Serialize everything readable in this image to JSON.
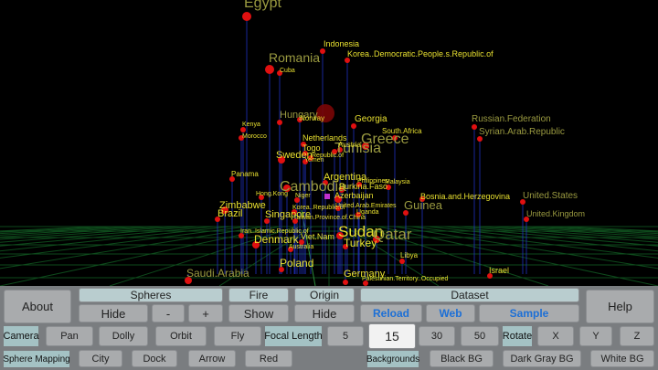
{
  "scene": {
    "labels": [
      {
        "t": "Egypt",
        "s": 16,
        "dim": true
      },
      {
        "t": "Indonesia",
        "s": 9
      },
      {
        "t": "Korea..Democratic.People.s.Republic.of",
        "s": 9
      },
      {
        "t": "Romania",
        "s": 14,
        "dim": true
      },
      {
        "t": "Cuba",
        "s": 7
      },
      {
        "t": "Hungary",
        "s": 11,
        "dim": true
      },
      {
        "t": "Norway",
        "s": 8
      },
      {
        "t": "Georgia",
        "s": 10
      },
      {
        "t": "Russian.Federation",
        "s": 10,
        "dim": true
      },
      {
        "t": "Syrian.Arab.Republic",
        "s": 10,
        "dim": true
      },
      {
        "t": "South.Africa",
        "s": 8
      },
      {
        "t": "Greece",
        "s": 16,
        "dim": true
      },
      {
        "t": "Tunisia",
        "s": 16,
        "dim": true
      },
      {
        "t": "Kenya",
        "s": 7
      },
      {
        "t": "Morocco",
        "s": 7
      },
      {
        "t": "Netherlands",
        "s": 9
      },
      {
        "t": "Austria",
        "s": 8
      },
      {
        "t": "Togo",
        "s": 9
      },
      {
        "t": "Sweden",
        "s": 11
      },
      {
        "t": "Republic.of",
        "s": 7
      },
      {
        "t": "Yemen",
        "s": 7
      },
      {
        "t": "Panama",
        "s": 8
      },
      {
        "t": "Argentina",
        "s": 11
      },
      {
        "t": "Cambodia",
        "s": 16,
        "dim": true
      },
      {
        "t": "Burkina.Faso",
        "s": 9
      },
      {
        "t": "Azerbaijan",
        "s": 9
      },
      {
        "t": "Philippines",
        "s": 7
      },
      {
        "t": "Malaysia",
        "s": 7
      },
      {
        "t": "Hong.Kong",
        "s": 7
      },
      {
        "t": "Niger",
        "s": 7
      },
      {
        "t": "Bosnia.and.Herzegovina",
        "s": 9
      },
      {
        "t": "United.States",
        "s": 10,
        "dim": true
      },
      {
        "t": "Guinea",
        "s": 13,
        "dim": true
      },
      {
        "t": "United.Arab.Emirates",
        "s": 7
      },
      {
        "t": "Uganda",
        "s": 7
      },
      {
        "t": "Zimbabwe",
        "s": 11
      },
      {
        "t": "Brazil",
        "s": 11
      },
      {
        "t": "Singapore",
        "s": 11
      },
      {
        "t": "Korea..Republic.of",
        "s": 7
      },
      {
        "t": "Taiwan.Province.of.China",
        "s": 7
      },
      {
        "t": "United.Kingdom",
        "s": 9,
        "dim": true
      },
      {
        "t": "Iran..Islamic.Republic.of",
        "s": 7
      },
      {
        "t": "Denmark",
        "s": 12
      },
      {
        "t": "Viet.Nam",
        "s": 9
      },
      {
        "t": "Sudan",
        "s": 17
      },
      {
        "t": "Qatar",
        "s": 17,
        "dim": true
      },
      {
        "t": "Turkey",
        "s": 12
      },
      {
        "t": "Australia",
        "s": 7
      },
      {
        "t": "Libya",
        "s": 8
      },
      {
        "t": "Poland",
        "s": 12
      },
      {
        "t": "Saudi.Arabia",
        "s": 12,
        "dim": true
      },
      {
        "t": "Germany",
        "s": 11
      },
      {
        "t": "Palestinian.Territory..Occupied",
        "s": 7
      },
      {
        "t": "Israel",
        "s": 9
      }
    ]
  },
  "toolbar": {
    "about": "About",
    "spheres": "Spheres",
    "fire": "Fire",
    "origin": "Origin",
    "dataset": "Dataset",
    "help": "Help",
    "hide_spheres": "Hide",
    "minus": "-",
    "plus": "+",
    "show": "Show",
    "hide_origin": "Hide",
    "reload": "Reload",
    "web": "Web",
    "sample": "Sample",
    "camera": "Camera",
    "pan": "Pan",
    "dolly": "Dolly",
    "orbit": "Orbit",
    "fly": "Fly",
    "focal_length": "Focal Length",
    "fl5": "5",
    "fl15": "15",
    "fl30": "30",
    "fl50": "50",
    "rotate": "Rotate",
    "x": "X",
    "y": "Y",
    "z": "Z",
    "sphere_mapping": "Sphere Mapping",
    "city": "City",
    "dock": "Dock",
    "arrow": "Arrow",
    "red": "Red",
    "backgrounds": "Backgrounds",
    "black_bg": "Black BG",
    "dark_gray_bg": "Dark Gray BG",
    "white_bg": "White BG"
  },
  "colors": {
    "label": "#e8e030",
    "sphere": "#e01010",
    "stem": "#2030c0",
    "grid": "#0e4a1c",
    "highlight": "#c030d0"
  }
}
